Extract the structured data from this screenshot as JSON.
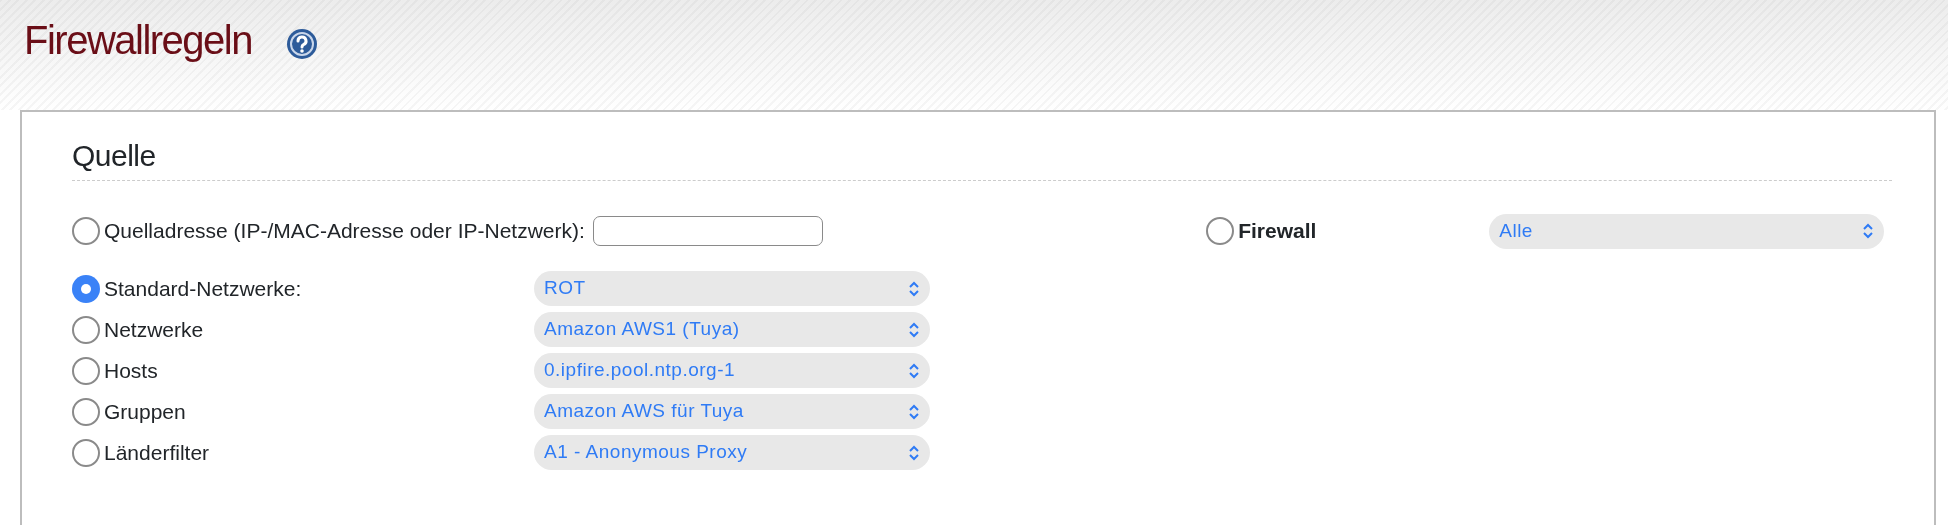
{
  "page_title": "Firewallregeln",
  "section": {
    "title": "Quelle",
    "source_address": {
      "label": "Quelladresse (IP-/MAC-Adresse oder IP-Netzwerk):",
      "selected": false
    },
    "firewall": {
      "label": "Firewall",
      "selected": false,
      "dropdown": "Alle"
    },
    "options": [
      {
        "label": "Standard-Netzwerke:",
        "selected": true,
        "dropdown": "ROT"
      },
      {
        "label": "Netzwerke",
        "selected": false,
        "dropdown": "Amazon AWS1 (Tuya)"
      },
      {
        "label": "Hosts",
        "selected": false,
        "dropdown": "0.ipfire.pool.ntp.org-1"
      },
      {
        "label": "Gruppen",
        "selected": false,
        "dropdown": "Amazon AWS für Tuya"
      },
      {
        "label": "Länderfilter",
        "selected": false,
        "dropdown": "A1 - Anonymous Proxy"
      }
    ]
  }
}
